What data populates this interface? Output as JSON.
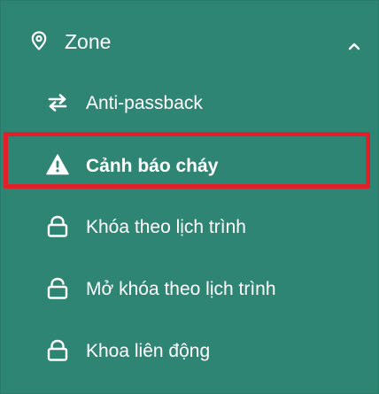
{
  "menu": {
    "zone": {
      "label": "Zone",
      "icon": "location-pin-icon",
      "expanded": true
    },
    "items": [
      {
        "label": "Anti-passback",
        "icon": "arrows-exchange-icon",
        "active": false
      },
      {
        "label": "Cảnh báo cháy",
        "icon": "warning-triangle-icon",
        "active": true
      },
      {
        "label": "Khóa theo lịch trình",
        "icon": "lock-icon",
        "active": false
      },
      {
        "label": "Mở khóa theo lịch trình",
        "icon": "unlock-icon",
        "active": false
      },
      {
        "label": "Khoa liên động",
        "icon": "lock-icon",
        "active": false
      }
    ]
  },
  "colors": {
    "panel_bg": "#2f8573",
    "text": "#ffffff",
    "highlight_border": "#e0212a"
  }
}
